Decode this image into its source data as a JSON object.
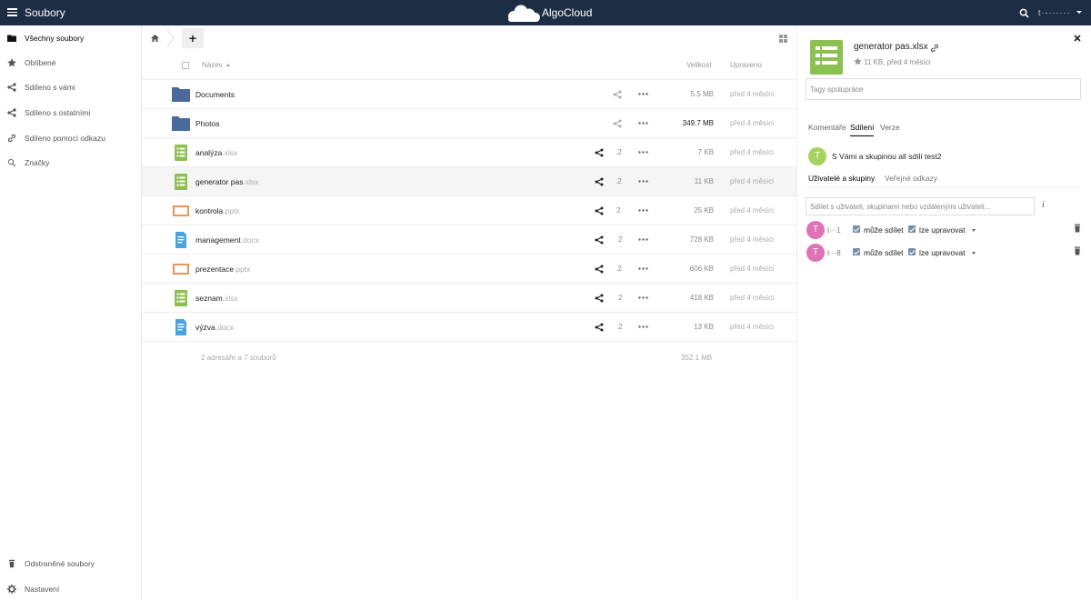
{
  "header": {
    "app_name": "Soubory",
    "brand": "AlgoCloud",
    "user_name": "t·-······"
  },
  "sidebar": {
    "items": [
      {
        "label": "Všechny soubory",
        "icon": "folder-icon"
      },
      {
        "label": "Oblíbené",
        "icon": "star-icon"
      },
      {
        "label": "Sdíleno s vámi",
        "icon": "share-icon"
      },
      {
        "label": "Sdíleno s ostatními",
        "icon": "share-icon"
      },
      {
        "label": "Sdíleno pomocí odkazu",
        "icon": "link-icon"
      },
      {
        "label": "Značky",
        "icon": "tag-icon"
      }
    ],
    "bottom": [
      {
        "label": "Odstraněné soubory",
        "icon": "trash-icon"
      },
      {
        "label": "Nastavení",
        "icon": "gear-icon"
      }
    ]
  },
  "controls": {
    "add_label": "+"
  },
  "columns": {
    "name": "Název",
    "size": "Velikost",
    "modified": "Upraveno"
  },
  "files": [
    {
      "name": "Documents",
      "ext": "",
      "type": "folder",
      "share_count": "",
      "size": "5.5 MB",
      "modified": "před 4 měsíci"
    },
    {
      "name": "Photos",
      "ext": "",
      "type": "folder",
      "share_count": "",
      "size": "349.7 MB",
      "modified": "před 4 měsíci"
    },
    {
      "name": "analýza",
      "ext": ".xlsx",
      "type": "spreadsheet",
      "share_count": ".2",
      "size": "7 KB",
      "modified": "před 4 měsíci"
    },
    {
      "name": "generator pas",
      "ext": ".xlsx",
      "type": "spreadsheet",
      "share_count": ".2",
      "size": "11 KB",
      "modified": "před 4 měsíci"
    },
    {
      "name": "kontrola",
      "ext": ".pptx",
      "type": "presentation",
      "share_count": "2",
      "size": "25 KB",
      "modified": "před 4 měsíci"
    },
    {
      "name": "management",
      "ext": ".docx",
      "type": "document",
      "share_count": "2",
      "size": "728 KB",
      "modified": "před 4 měsíci"
    },
    {
      "name": "prezentace",
      "ext": ".pptx",
      "type": "presentation",
      "share_count": ".2",
      "size": "606 KB",
      "modified": "před 4 měsíci"
    },
    {
      "name": "seznam",
      "ext": ".xlsx",
      "type": "spreadsheet",
      "share_count": "2",
      "size": "418 KB",
      "modified": "před 4 měsíci"
    },
    {
      "name": "výzva",
      "ext": ".docx",
      "type": "document",
      "share_count": "2",
      "size": "13 KB",
      "modified": "před 4 měsíci"
    }
  ],
  "summary": {
    "text": "2 adresáře a 7 souborů",
    "size": "352.1 MB"
  },
  "details": {
    "filename": "generator pas.xlsx",
    "meta": "11 KB, před 4 měsíci",
    "tags_placeholder": "Tagy spolupráce",
    "tabs": [
      "Komentáře",
      "Sdílení",
      "Verze"
    ],
    "shared_with": {
      "avatar": "T",
      "text": "S Vámi a skupinou all sdílí test2"
    },
    "subtabs": [
      "Uživatelé a skupiny",
      "Veřejné odkazy"
    ],
    "share_placeholder": "Sdílet s uživateli, skupinami nebo vzdálenými uživateli...",
    "info": "i",
    "sharees": [
      {
        "avatar": "T",
        "name": "t···1",
        "can_share": "může sdílet",
        "can_edit": "lze upravovat"
      },
      {
        "avatar": "T",
        "name": "t···8",
        "can_share": "může sdílet",
        "can_edit": "lze upravovat"
      }
    ]
  },
  "colors": {
    "header": "#1d2d44",
    "folder": "#4a6a9b",
    "spreadsheet": "#8cc152",
    "presentation": "#e8945a",
    "document": "#4aa3df"
  }
}
